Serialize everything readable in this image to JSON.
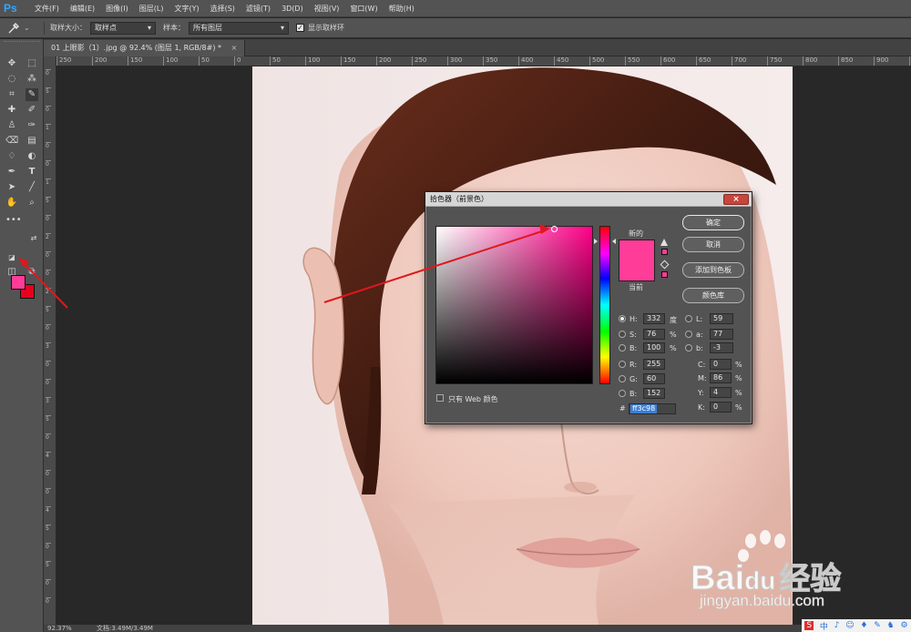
{
  "app": {
    "logo": "Ps"
  },
  "menubar": {
    "items": [
      "文件(F)",
      "编辑(E)",
      "图像(I)",
      "图层(L)",
      "文字(Y)",
      "选择(S)",
      "滤镜(T)",
      "3D(D)",
      "视图(V)",
      "窗口(W)",
      "帮助(H)"
    ]
  },
  "options": {
    "tool_icon": "eyedropper-icon",
    "sample_size_label": "取样大小：",
    "sample_size_value": "取样点",
    "sample_label": "样本：",
    "sample_value": "所有图层",
    "show_ring_label": "显示取样环",
    "show_ring_checked": true
  },
  "document": {
    "tab_title": "01 上眼影（1）.jpg @ 92.4% (图层 1, RGB/8#) *",
    "tab_close": "×"
  },
  "ruler": {
    "top_labels": [
      "250",
      "200",
      "150",
      "100",
      "50",
      "0",
      "50",
      "100",
      "150",
      "200",
      "250",
      "300",
      "350",
      "400",
      "450",
      "500",
      "550",
      "600",
      "650",
      "700",
      "750",
      "800",
      "850",
      "900",
      "950"
    ],
    "left_labels": [
      "0",
      "5",
      "0",
      "1",
      "0",
      "0",
      "1",
      "5",
      "0",
      "2",
      "0",
      "0",
      "2",
      "5",
      "0",
      "3",
      "0",
      "0",
      "3",
      "5",
      "0",
      "4",
      "0",
      "0",
      "4",
      "5",
      "0",
      "5",
      "0",
      "0"
    ]
  },
  "tools": {
    "foreground_color": "#ff3c98",
    "background_color": "#e8001c"
  },
  "status": {
    "zoom": "92.37%",
    "doc": "文档:3.49M/3.49M"
  },
  "color_picker": {
    "title": "拾色器（前景色）",
    "new_label": "新的",
    "current_label": "当前",
    "new_color": "#ff3c98",
    "current_color": "#ff3c98",
    "buttons": {
      "ok": "确定",
      "cancel": "取消",
      "add_to_swatches": "添加到色板",
      "color_libraries": "颜色库"
    },
    "web_only_label": "只有 Web 颜色",
    "hsb": {
      "h": "332",
      "s": "76",
      "b": "100",
      "h_unit": "度",
      "s_unit": "%",
      "b_unit": "%"
    },
    "rgb": {
      "r": "255",
      "g": "60",
      "b": "152"
    },
    "lab": {
      "l": "59",
      "a": "77",
      "b": "-3"
    },
    "cmyk": {
      "c": "0",
      "m": "86",
      "y": "4",
      "k": "0",
      "unit": "%"
    },
    "labels": {
      "h": "H:",
      "s": "S:",
      "b": "B:",
      "r": "R:",
      "g": "G:",
      "bl": "B:",
      "l": "L:",
      "a": "a:",
      "lb": "b:",
      "c": "C:",
      "m": "M:",
      "y": "Y:",
      "k": "K:",
      "hash": "#"
    },
    "hex": "ff3c98"
  },
  "watermark": {
    "brand": "Bai",
    "brand2": "du",
    "cn": "经验",
    "url": "jingyan.baidu.com"
  },
  "tray": {
    "items": [
      "S",
      "中",
      "♪",
      "☺",
      "♦",
      "✎",
      "♞",
      "⚙"
    ]
  }
}
